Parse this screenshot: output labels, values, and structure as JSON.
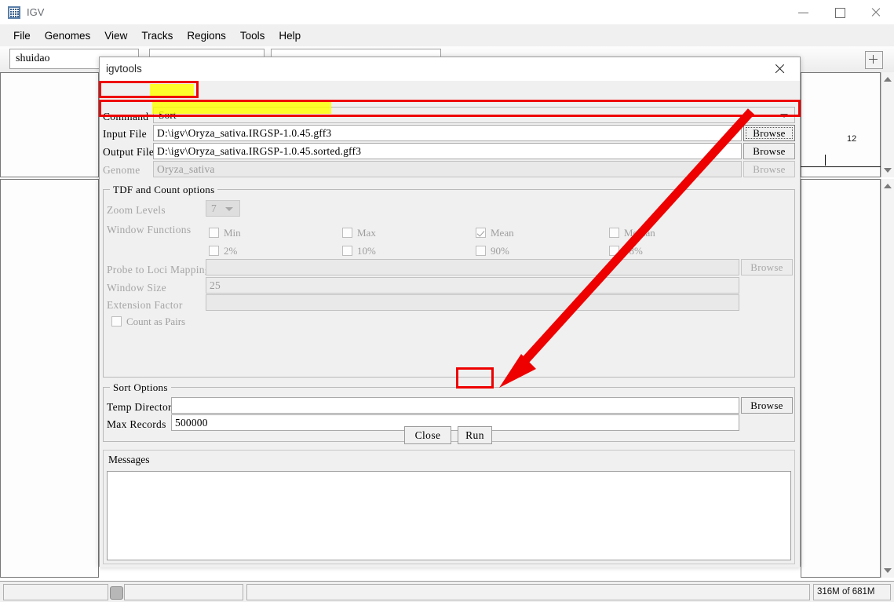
{
  "window": {
    "title": "IGV",
    "icon": "igv-app-icon",
    "controls": {
      "minimize": "minimize-icon",
      "maximize": "maximize-icon",
      "close": "close-icon"
    }
  },
  "menubar": {
    "items": [
      "File",
      "Genomes",
      "View",
      "Tracks",
      "Regions",
      "Tools",
      "Help"
    ]
  },
  "toolbar": {
    "genome_selected": "shuidao",
    "locus_value": "",
    "search_value": "",
    "add_panel_label": "+"
  },
  "background": {
    "track_value_label": "12",
    "scrollbars": [
      "up",
      "down"
    ]
  },
  "dialog": {
    "title": "igvtools",
    "close_label": "×",
    "fields": {
      "command": {
        "label": "Command",
        "value": "Sort"
      },
      "input_file": {
        "label": "Input File",
        "value": "D:\\igv\\Oryza_sativa.IRGSP-1.0.45.gff3",
        "browse": "Browse"
      },
      "output_file": {
        "label": "Output File",
        "value": "D:\\igv\\Oryza_sativa.IRGSP-1.0.45.sorted.gff3",
        "browse": "Browse"
      },
      "genome": {
        "label": "Genome",
        "value": "Oryza_sativa",
        "browse": "Browse"
      }
    },
    "tdf_group": {
      "title": "TDF and Count options",
      "zoom_levels": {
        "label": "Zoom Levels",
        "value": "7"
      },
      "window_functions": {
        "label": "Window Functions",
        "row1": [
          {
            "label": "Min",
            "checked": false
          },
          {
            "label": "Max",
            "checked": false
          },
          {
            "label": "Mean",
            "checked": true
          },
          {
            "label": "Median",
            "checked": false
          }
        ],
        "row2": [
          {
            "label": "2%",
            "checked": false
          },
          {
            "label": "10%",
            "checked": false
          },
          {
            "label": "90%",
            "checked": false
          },
          {
            "label": "98%",
            "checked": false
          }
        ]
      },
      "probe_to_loci": {
        "label": "Probe to Loci Mapping",
        "value": "",
        "browse": "Browse"
      },
      "window_size": {
        "label": "Window Size",
        "value": "25"
      },
      "extension_factor": {
        "label": "Extension Factor",
        "value": ""
      },
      "count_as_pairs": {
        "label": "Count as Pairs",
        "checked": false
      }
    },
    "sort_group": {
      "title": "Sort Options",
      "temp_directory": {
        "label": "Temp Directory",
        "value": "",
        "browse": "Browse"
      },
      "max_records": {
        "label": "Max Records",
        "value": "500000"
      }
    },
    "actions": {
      "close": "Close",
      "run": "Run"
    },
    "messages": {
      "label": "Messages",
      "text": ""
    }
  },
  "statusbar": {
    "left_cell": "",
    "middle_cell": "",
    "right_cell": "",
    "memory": "316M of 681M"
  },
  "annotations": {
    "highlight_color": "#ffff00",
    "box_color": "#ee0000",
    "arrow_color": "#ee0000"
  }
}
